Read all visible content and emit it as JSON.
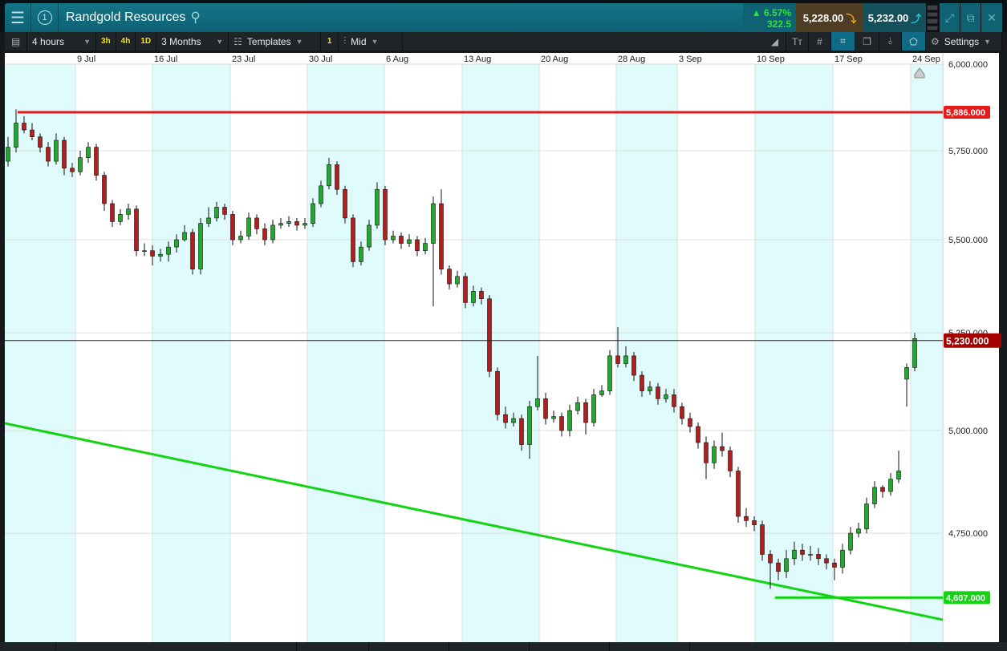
{
  "header": {
    "title": "Randgold Resources",
    "window_number": "1",
    "change_pct": "6.57%",
    "change_abs": "322.5",
    "sell_price": "5,228.00",
    "buy_price": "5,232.00"
  },
  "toolbar": {
    "interval": "4 hours",
    "quick_intervals": [
      "3h",
      "4h",
      "1D"
    ],
    "range": "3 Months",
    "templates": "Templates",
    "layer_count": "1",
    "price_type": "Mid",
    "settings": "Settings"
  },
  "colors": {
    "up": "#22a82c",
    "down": "#b01e1e",
    "band": "#e0fbfc",
    "resistance": "#e31b1b",
    "support": "#14d214",
    "current": "#a50000"
  },
  "chart_data": {
    "type": "candlestick",
    "x_ticks": [
      "9 Jul",
      "16 Jul",
      "23 Jul",
      "30 Jul",
      "6 Aug",
      "13 Aug",
      "20 Aug",
      "28 Aug",
      "3 Sep",
      "10 Sep",
      "17 Sep",
      "24 Sep"
    ],
    "y_ticks": [
      6000,
      5750,
      5500,
      5250,
      5000,
      4750
    ],
    "y_tick_labels": [
      "6,000.000",
      "5,750.000",
      "5,500.000",
      "5,250.000",
      "5,000.000",
      "4,750.000"
    ],
    "scale": "log",
    "levels": {
      "resistance": {
        "value": 5886,
        "label": "5,886.000"
      },
      "current": {
        "value": 5230,
        "label": "5,230.000"
      },
      "support": {
        "value": 4607,
        "label": "4,607.000"
      }
    },
    "trendline": {
      "start_price": 5018,
      "end_price": 4549
    },
    "candles": [
      [
        5720,
        5790,
        5705,
        5760
      ],
      [
        5760,
        5870,
        5745,
        5830
      ],
      [
        5830,
        5850,
        5800,
        5810
      ],
      [
        5810,
        5830,
        5780,
        5790
      ],
      [
        5790,
        5800,
        5745,
        5760
      ],
      [
        5760,
        5775,
        5705,
        5720
      ],
      [
        5720,
        5800,
        5710,
        5780
      ],
      [
        5780,
        5790,
        5680,
        5700
      ],
      [
        5700,
        5715,
        5675,
        5690
      ],
      [
        5690,
        5750,
        5680,
        5730
      ],
      [
        5730,
        5775,
        5715,
        5760
      ],
      [
        5760,
        5770,
        5665,
        5680
      ],
      [
        5680,
        5690,
        5580,
        5600
      ],
      [
        5600,
        5610,
        5535,
        5550
      ],
      [
        5550,
        5585,
        5540,
        5570
      ],
      [
        5570,
        5600,
        5555,
        5585
      ],
      [
        5585,
        5595,
        5455,
        5470
      ],
      [
        5470,
        5490,
        5455,
        5470
      ],
      [
        5470,
        5485,
        5430,
        5455
      ],
      [
        5455,
        5475,
        5440,
        5460
      ],
      [
        5460,
        5495,
        5440,
        5480
      ],
      [
        5480,
        5515,
        5465,
        5500
      ],
      [
        5500,
        5540,
        5495,
        5520
      ],
      [
        5520,
        5530,
        5405,
        5420
      ],
      [
        5420,
        5560,
        5405,
        5545
      ],
      [
        5545,
        5590,
        5535,
        5560
      ],
      [
        5560,
        5605,
        5550,
        5590
      ],
      [
        5590,
        5600,
        5555,
        5570
      ],
      [
        5570,
        5580,
        5485,
        5500
      ],
      [
        5500,
        5525,
        5490,
        5510
      ],
      [
        5510,
        5575,
        5500,
        5560
      ],
      [
        5560,
        5570,
        5515,
        5530
      ],
      [
        5530,
        5545,
        5485,
        5500
      ],
      [
        5500,
        5555,
        5490,
        5540
      ],
      [
        5540,
        5560,
        5530,
        5545
      ],
      [
        5545,
        5565,
        5535,
        5550
      ],
      [
        5550,
        5560,
        5525,
        5540
      ],
      [
        5540,
        5560,
        5530,
        5545
      ],
      [
        5545,
        5615,
        5535,
        5600
      ],
      [
        5600,
        5665,
        5590,
        5650
      ],
      [
        5650,
        5730,
        5640,
        5710
      ],
      [
        5710,
        5720,
        5625,
        5640
      ],
      [
        5640,
        5650,
        5545,
        5560
      ],
      [
        5560,
        5570,
        5425,
        5440
      ],
      [
        5440,
        5495,
        5430,
        5480
      ],
      [
        5480,
        5555,
        5470,
        5540
      ],
      [
        5540,
        5660,
        5530,
        5640
      ],
      [
        5640,
        5650,
        5485,
        5500
      ],
      [
        5500,
        5525,
        5490,
        5510
      ],
      [
        5510,
        5520,
        5475,
        5490
      ],
      [
        5490,
        5515,
        5480,
        5500
      ],
      [
        5500,
        5510,
        5455,
        5470
      ],
      [
        5470,
        5505,
        5460,
        5490
      ],
      [
        5490,
        5620,
        5320,
        5600
      ],
      [
        5600,
        5640,
        5405,
        5420
      ],
      [
        5420,
        5430,
        5365,
        5380
      ],
      [
        5380,
        5415,
        5370,
        5400
      ],
      [
        5400,
        5410,
        5315,
        5330
      ],
      [
        5330,
        5375,
        5320,
        5360
      ],
      [
        5360,
        5370,
        5325,
        5340
      ],
      [
        5340,
        5350,
        5135,
        5150
      ],
      [
        5150,
        5160,
        5025,
        5040
      ],
      [
        5040,
        5060,
        5005,
        5020
      ],
      [
        5020,
        5045,
        5010,
        5030
      ],
      [
        5030,
        5040,
        4950,
        4965
      ],
      [
        4965,
        5075,
        4930,
        5060
      ],
      [
        5060,
        5190,
        5050,
        5080
      ],
      [
        5080,
        5095,
        5015,
        5030
      ],
      [
        5030,
        5050,
        5020,
        5035
      ],
      [
        5035,
        5045,
        4985,
        5000
      ],
      [
        5000,
        5065,
        4985,
        5050
      ],
      [
        5050,
        5085,
        5040,
        5070
      ],
      [
        5070,
        5080,
        4990,
        5020
      ],
      [
        5020,
        5105,
        5010,
        5090
      ],
      [
        5090,
        5115,
        5085,
        5100
      ],
      [
        5100,
        5205,
        5090,
        5190
      ],
      [
        5190,
        5265,
        5160,
        5170
      ],
      [
        5170,
        5215,
        5160,
        5190
      ],
      [
        5190,
        5200,
        5125,
        5140
      ],
      [
        5140,
        5150,
        5085,
        5100
      ],
      [
        5100,
        5125,
        5090,
        5110
      ],
      [
        5110,
        5120,
        5065,
        5080
      ],
      [
        5080,
        5105,
        5070,
        5090
      ],
      [
        5090,
        5105,
        5045,
        5060
      ],
      [
        5060,
        5070,
        5015,
        5030
      ],
      [
        5030,
        5045,
        4995,
        5010
      ],
      [
        5010,
        5020,
        4955,
        4970
      ],
      [
        4970,
        4985,
        4880,
        4920
      ],
      [
        4920,
        4975,
        4905,
        4960
      ],
      [
        4960,
        4995,
        4935,
        4950
      ],
      [
        4950,
        4960,
        4885,
        4900
      ],
      [
        4900,
        4910,
        4775,
        4790
      ],
      [
        4790,
        4810,
        4765,
        4780
      ],
      [
        4780,
        4790,
        4755,
        4770
      ],
      [
        4770,
        4780,
        4685,
        4700
      ],
      [
        4700,
        4710,
        4620,
        4680
      ],
      [
        4680,
        4690,
        4640,
        4660
      ],
      [
        4660,
        4710,
        4645,
        4690
      ],
      [
        4690,
        4730,
        4675,
        4710
      ],
      [
        4710,
        4725,
        4685,
        4700
      ],
      [
        4700,
        4720,
        4685,
        4700
      ],
      [
        4700,
        4715,
        4675,
        4690
      ],
      [
        4690,
        4700,
        4665,
        4680
      ],
      [
        4680,
        4690,
        4640,
        4670
      ],
      [
        4670,
        4725,
        4655,
        4710
      ],
      [
        4710,
        4765,
        4700,
        4750
      ],
      [
        4750,
        4775,
        4740,
        4760
      ],
      [
        4760,
        4835,
        4750,
        4820
      ],
      [
        4820,
        4875,
        4810,
        4860
      ],
      [
        4860,
        4865,
        4835,
        4850
      ],
      [
        4850,
        4895,
        4840,
        4880
      ],
      [
        4880,
        4950,
        4870,
        4900
      ],
      [
        5130,
        5170,
        5060,
        5160
      ],
      [
        5160,
        5250,
        5150,
        5235
      ]
    ]
  }
}
